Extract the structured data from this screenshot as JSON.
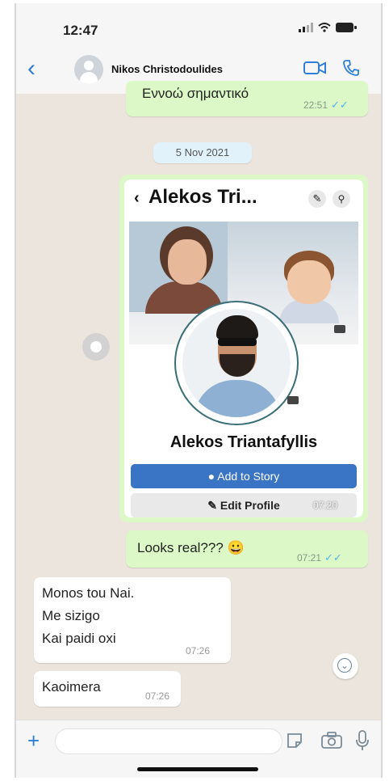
{
  "status_bar": {
    "time": "12:47"
  },
  "header": {
    "back_icon": "‹",
    "contact_name": "Nikos Christodoulides"
  },
  "messages": {
    "top_partial": {
      "text": "Εννοώ σημαντικό",
      "time": "22:51",
      "ticks": "✓✓"
    },
    "date_chip": "5 Nov 2021",
    "image_message": {
      "time": "07:20",
      "fb": {
        "title": "Alekos Tri...",
        "back_icon": "‹",
        "edit_icon": "✎",
        "search_icon": "⚲",
        "name": "Alekos Triantafyllis",
        "add_story": "● Add to Story",
        "edit_profile": "✎ Edit Profile"
      }
    },
    "out_1": {
      "text": "Looks real??? 😀",
      "time": "07:21",
      "ticks": "✓✓"
    },
    "in_1": {
      "lines": [
        "Monos tou Nai.",
        "Me sizigo",
        "Kai paidi oxi"
      ],
      "time": "07:26"
    },
    "in_2": {
      "text": "Kaoimera",
      "time": "07:26"
    }
  },
  "composer": {
    "plus": "+"
  },
  "colors": {
    "outgoing": "#dcf8c6",
    "incoming": "#ffffff",
    "accent": "#2f7fd8",
    "read_ticks": "#4fb6ec"
  }
}
